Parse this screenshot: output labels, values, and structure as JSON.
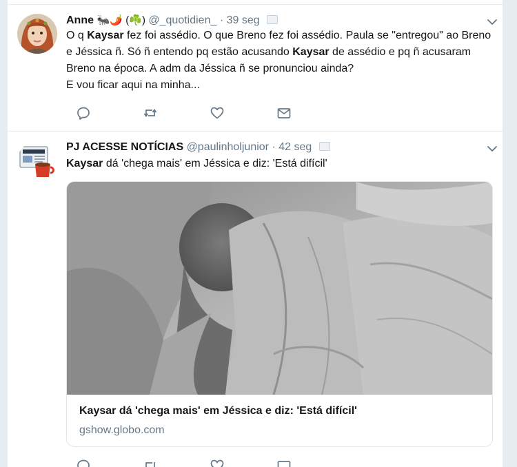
{
  "tweets": [
    {
      "name": "Anne",
      "name_emojis": "🐜🌶️",
      "name_suffix": "(☘️)",
      "handle": "@_quotidien_",
      "time": "39 seg",
      "avatar": "avatar-woman-red-hair",
      "text_parts": {
        "t1": "O q ",
        "b1": "Kaysar",
        "t2": " fez foi assédio. O que Breno fez foi assédio. Paula se \"entregou\" ao Breno e Jéssica ñ. Só ñ entendo pq estão acusando ",
        "b2": "Kaysar",
        "t3": " de assédio e pq ñ acusaram Breno na época. A adm da Jéssica ñ se pronunciou ainda?",
        "t4": "E vou ficar aqui na minha..."
      }
    },
    {
      "name": "PJ ACESSE NOTÍCIAS",
      "handle": "@paulinholjunior",
      "time": "42 seg",
      "avatar": "avatar-news-icon",
      "text_parts": {
        "b1": "Kaysar",
        "t1": " dá 'chega mais' em Jéssica e diz: 'Está difícil'"
      },
      "card": {
        "image": "grayscale-photo-person-under-blanket",
        "title": "Kaysar dá 'chega mais' em Jéssica e diz: 'Está difícil'",
        "domain": "gshow.globo.com"
      }
    }
  ],
  "separator": "·",
  "icons": [
    "reply-icon",
    "retweet-icon",
    "like-icon",
    "direct-message-icon",
    "chevron-down-icon"
  ],
  "colors": {
    "background": "#e6ecf0",
    "text": "#14171a",
    "secondary": "#657786",
    "icon": "#657786"
  }
}
